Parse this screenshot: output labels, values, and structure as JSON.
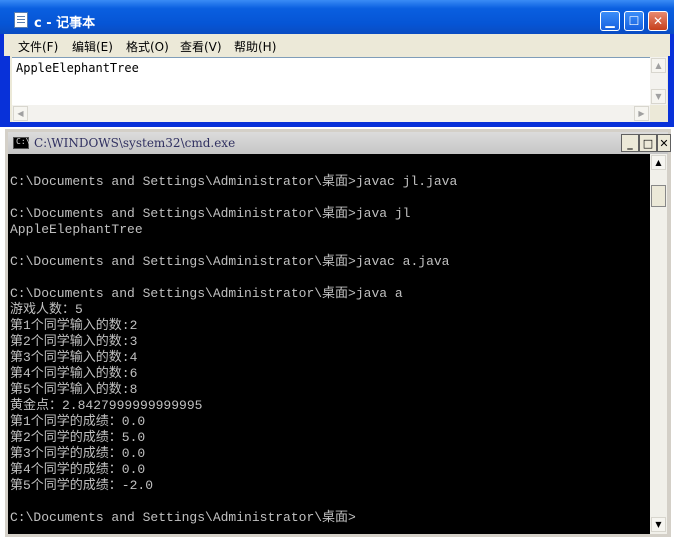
{
  "notepad": {
    "title": "c - 记事本",
    "menus": [
      "文件(F)",
      "编辑(E)",
      "格式(O)",
      "查看(V)",
      "帮助(H)"
    ],
    "content": "AppleElephantTree"
  },
  "cmd": {
    "title": "C:\\WINDOWS\\system32\\cmd.exe",
    "lines": [
      "",
      "C:\\Documents and Settings\\Administrator\\桌面>javac jl.java",
      "",
      "C:\\Documents and Settings\\Administrator\\桌面>java jl",
      "AppleElephantTree",
      "",
      "C:\\Documents and Settings\\Administrator\\桌面>javac a.java",
      "",
      "C:\\Documents and Settings\\Administrator\\桌面>java a",
      "游戏人数：5",
      "第1个同学输入的数:2",
      "第2个同学输入的数:3",
      "第3个同学输入的数:4",
      "第4个同学输入的数:6",
      "第5个同学输入的数:8",
      "黄金点：2.8427999999999995",
      "第1个同学的成绩：0.0",
      "第2个同学的成绩：5.0",
      "第3个同学的成绩：0.0",
      "第4个同学的成绩：0.0",
      "第5个同学的成绩：-2.0",
      "",
      "C:\\Documents and Settings\\Administrator\\桌面>"
    ]
  },
  "colors": {
    "notepad_frame": "#0831d9",
    "console_bg": "#000000",
    "console_text": "#c0c0c0"
  }
}
